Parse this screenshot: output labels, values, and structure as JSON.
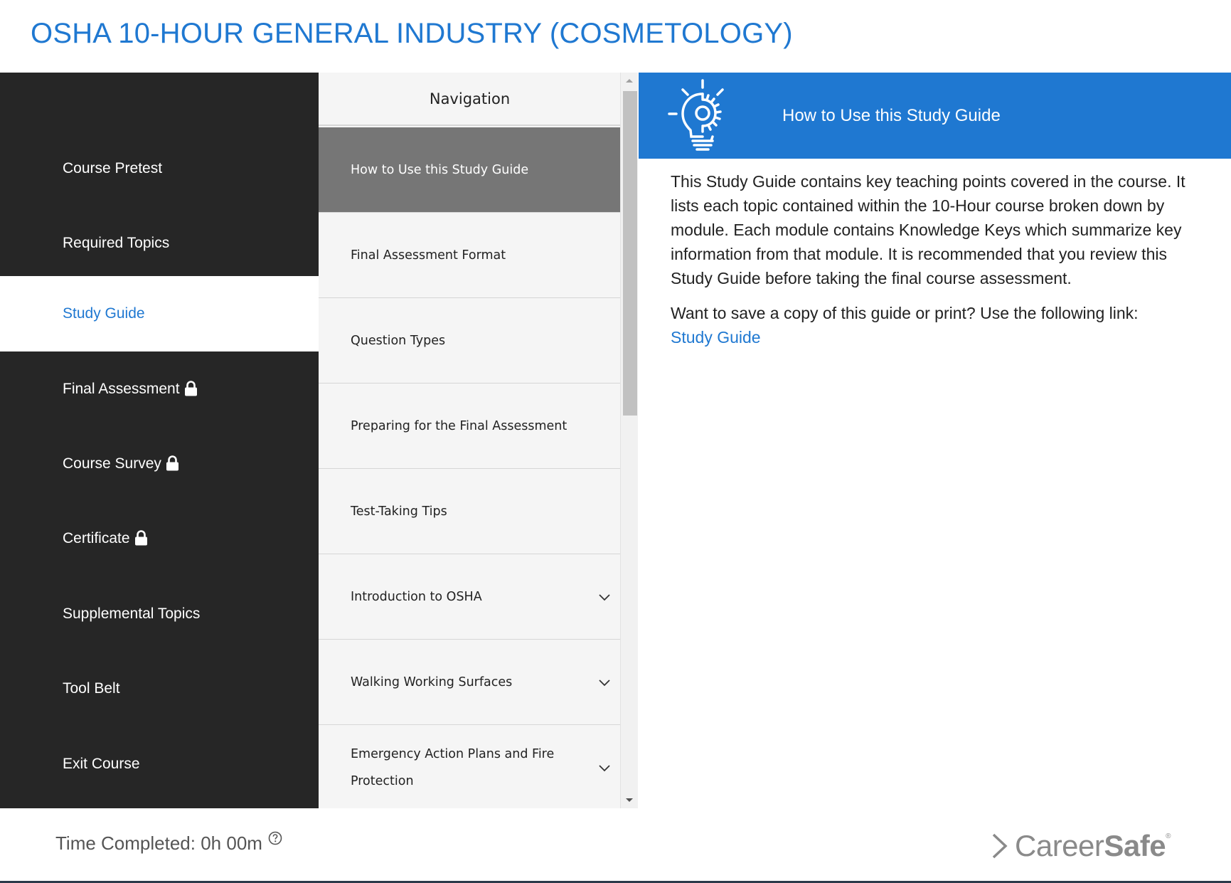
{
  "header": {
    "course_title": "OSHA 10-HOUR GENERAL INDUSTRY (COSMETOLOGY)"
  },
  "sidebar": {
    "items": [
      {
        "label": "Course Pretest",
        "locked": false,
        "active": false
      },
      {
        "label": "Required Topics",
        "locked": false,
        "active": false
      },
      {
        "label": "Study Guide",
        "locked": false,
        "active": true
      },
      {
        "label": "Final Assessment",
        "locked": true,
        "active": false
      },
      {
        "label": "Course Survey",
        "locked": true,
        "active": false
      },
      {
        "label": "Certificate",
        "locked": true,
        "active": false
      },
      {
        "label": "Supplemental Topics",
        "locked": false,
        "active": false
      },
      {
        "label": "Tool Belt",
        "locked": false,
        "active": false
      },
      {
        "label": "Exit Course",
        "locked": false,
        "active": false
      }
    ]
  },
  "navigation": {
    "title": "Navigation",
    "items": [
      {
        "label": "How to Use this Study Guide",
        "expandable": false,
        "active": true
      },
      {
        "label": "Final Assessment Format",
        "expandable": false,
        "active": false
      },
      {
        "label": "Question Types",
        "expandable": false,
        "active": false
      },
      {
        "label": "Preparing for the Final Assessment",
        "expandable": false,
        "active": false
      },
      {
        "label": "Test-Taking Tips",
        "expandable": false,
        "active": false
      },
      {
        "label": "Introduction to OSHA",
        "expandable": true,
        "active": false
      },
      {
        "label": "Walking Working Surfaces",
        "expandable": true,
        "active": false
      },
      {
        "label": "Emergency Action Plans and Fire Protection",
        "expandable": true,
        "active": false
      }
    ]
  },
  "content": {
    "icon": "lightbulb-gear-icon",
    "title": "How to Use this Study Guide",
    "paragraph1": "This Study Guide contains key teaching points covered in the course. It lists each topic contained within the 10-Hour course broken down by module. Each module contains Knowledge Keys which summarize key information from that module. It is recommended that you review this Study Guide before taking the final course assessment.",
    "paragraph2": "Want to save a copy of this guide or print? Use the following link:",
    "link_label": "Study Guide"
  },
  "footer": {
    "time_completed": "Time Completed: 0h 00m",
    "brand_career": "Career",
    "brand_safe": "Safe",
    "brand_reg": "®"
  },
  "colors": {
    "accent": "#1f78d1",
    "sidebar_bg": "#262626",
    "nav_active_bg": "#767676"
  }
}
